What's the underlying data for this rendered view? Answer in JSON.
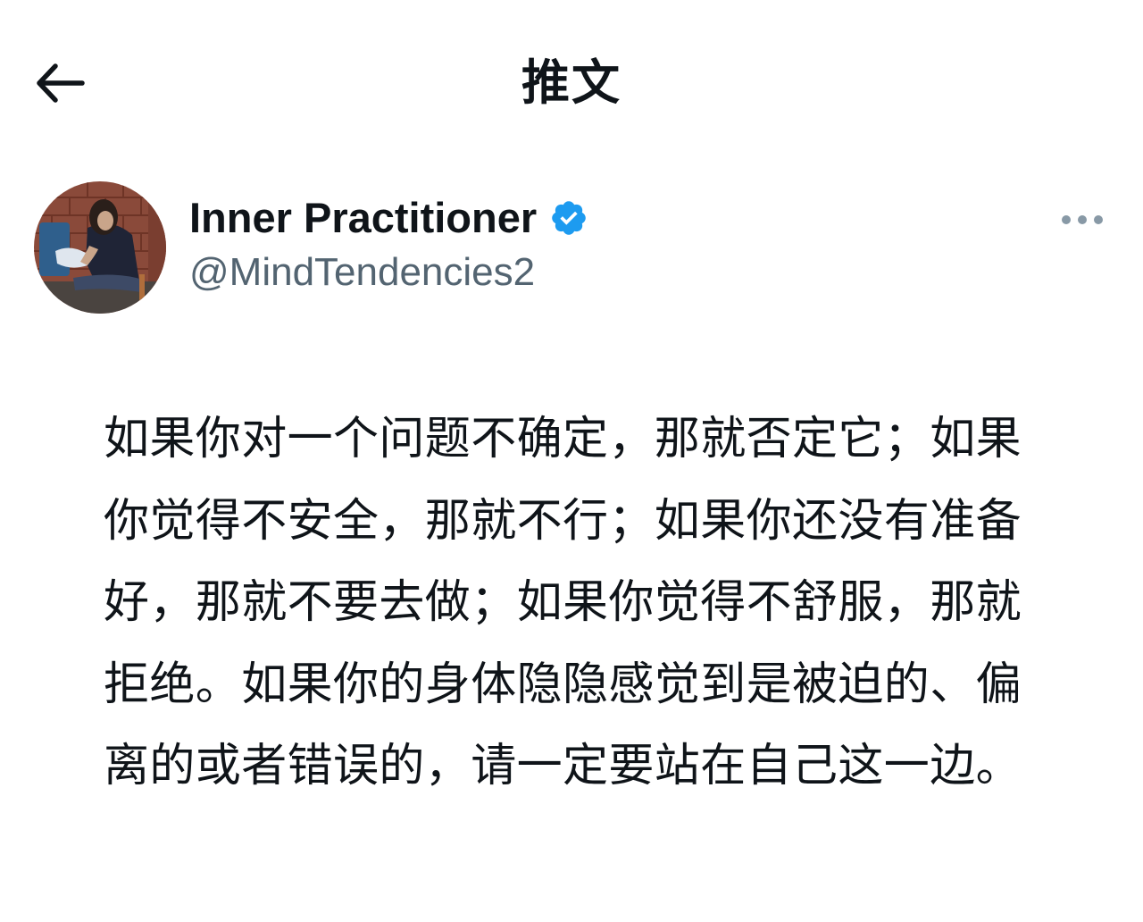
{
  "header": {
    "title": "推文",
    "back_icon": "arrow-left-icon"
  },
  "author": {
    "display_name": "Inner Practitioner",
    "handle": "@MindTendencies2",
    "verified": true,
    "verified_icon": "verified-badge-icon",
    "verified_color": "#1d9bf0",
    "avatar_icon": "avatar-photo",
    "more_icon": "more-horizontal-icon"
  },
  "tweet": {
    "text": "如果你对一个问题不确定，那就否定它；如果你觉得不安全，那就不行；如果你还没有准备好，那就不要去做；如果你觉得不舒服，那就拒绝。如果你的身体隐隐感觉到是被迫的、偏离的或者错误的，请一定要站在自己这一边。"
  },
  "colors": {
    "text_primary": "#0f1419",
    "text_secondary": "#536471",
    "background": "#ffffff"
  }
}
